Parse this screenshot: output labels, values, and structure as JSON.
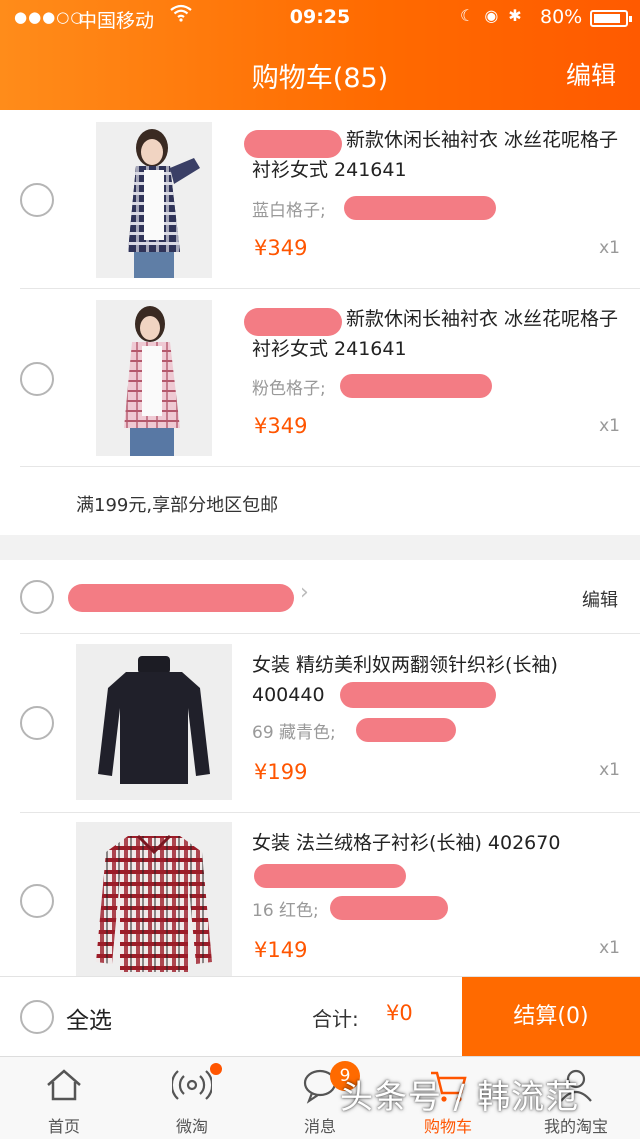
{
  "status_bar": {
    "carrier": "中国移动",
    "time": "09:25",
    "battery": "80%",
    "signal_icon": "signal-dots-icon",
    "wifi_icon": "wifi-icon"
  },
  "header": {
    "title": "购物车(85)",
    "edit": "编辑",
    "color": "#ff6a00"
  },
  "store1": {
    "items": [
      {
        "title": "新款休闲长袖衬衣 冰丝花呢格子衬衫女式 241641",
        "sku": "蓝白格子;",
        "price": "¥349",
        "qty": "x1"
      },
      {
        "title": "新款休闲长袖衬衣 冰丝花呢格子衬衫女式 241641",
        "sku": "粉色格子;",
        "price": "¥349",
        "qty": "x1"
      }
    ],
    "promo": "满199元,享部分地区包邮"
  },
  "store2": {
    "edit": "编辑",
    "items": [
      {
        "title": "女装 精纺美利奴两翻领针织衫(长袖) 400440",
        "sku": "69 藏青色;",
        "price": "¥199",
        "qty": "x1"
      },
      {
        "title": "女装 法兰绒格子衬衫(长袖) 402670",
        "sku": "16 红色;",
        "price": "¥149",
        "qty": "x1"
      }
    ]
  },
  "checkout": {
    "select_all": "全选",
    "total_label": "合计:",
    "total_value": "¥0",
    "pay_button": "结算(0)"
  },
  "tabs": [
    {
      "label": "首页",
      "icon": "home-icon"
    },
    {
      "label": "微淘",
      "icon": "broadcast-icon"
    },
    {
      "label": "消息",
      "icon": "message-icon",
      "badge": "9"
    },
    {
      "label": "购物车",
      "icon": "cart-icon",
      "active": true
    },
    {
      "label": "我的淘宝",
      "icon": "profile-icon"
    }
  ],
  "watermark": "头条号 / 韩流范",
  "colors": {
    "accent": "#ff5500",
    "redaction": "#f2717a"
  }
}
